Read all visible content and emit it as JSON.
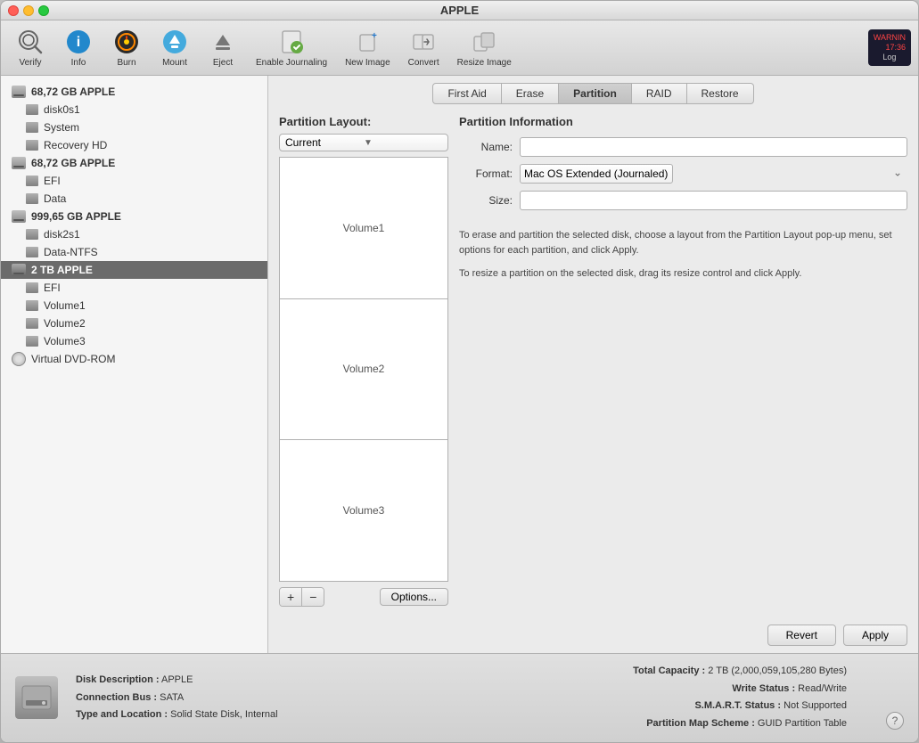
{
  "window": {
    "title": "APPLE"
  },
  "toolbar": {
    "items": [
      {
        "id": "verify",
        "label": "Verify",
        "icon": "verify"
      },
      {
        "id": "info",
        "label": "Info",
        "icon": "info"
      },
      {
        "id": "burn",
        "label": "Burn",
        "icon": "burn"
      },
      {
        "id": "mount",
        "label": "Mount",
        "icon": "mount"
      },
      {
        "id": "eject",
        "label": "Eject",
        "icon": "eject"
      },
      {
        "id": "enable-journaling",
        "label": "Enable Journaling",
        "icon": "journaling"
      },
      {
        "id": "new-image",
        "label": "New Image",
        "icon": "new-image"
      },
      {
        "id": "convert",
        "label": "Convert",
        "icon": "convert"
      },
      {
        "id": "resize-image",
        "label": "Resize Image",
        "icon": "resize-image"
      }
    ],
    "log_label": "Log",
    "log_badge_line1": "WARNIN",
    "log_badge_line2": "17:36"
  },
  "sidebar": {
    "items": [
      {
        "id": "disk1",
        "label": "68,72 GB APPLE",
        "type": "disk",
        "indent": 0
      },
      {
        "id": "disk0s1",
        "label": "disk0s1",
        "type": "volume",
        "indent": 1
      },
      {
        "id": "system",
        "label": "System",
        "type": "volume",
        "indent": 1
      },
      {
        "id": "recovery-hd",
        "label": "Recovery HD",
        "type": "volume",
        "indent": 1
      },
      {
        "id": "disk2",
        "label": "68,72 GB APPLE",
        "type": "disk",
        "indent": 0
      },
      {
        "id": "efi1",
        "label": "EFI",
        "type": "volume",
        "indent": 1
      },
      {
        "id": "data",
        "label": "Data",
        "type": "volume",
        "indent": 1
      },
      {
        "id": "disk3",
        "label": "999,65 GB APPLE",
        "type": "disk",
        "indent": 0
      },
      {
        "id": "disk2s1",
        "label": "disk2s1",
        "type": "volume",
        "indent": 1
      },
      {
        "id": "data-ntfs",
        "label": "Data-NTFS",
        "type": "volume",
        "indent": 1
      },
      {
        "id": "disk4",
        "label": "2 TB APPLE",
        "type": "disk",
        "indent": 0,
        "selected": true
      },
      {
        "id": "efi2",
        "label": "EFI",
        "type": "volume",
        "indent": 1
      },
      {
        "id": "volume1",
        "label": "Volume1",
        "type": "volume",
        "indent": 1
      },
      {
        "id": "volume2",
        "label": "Volume2",
        "type": "volume",
        "indent": 1
      },
      {
        "id": "volume3",
        "label": "Volume3",
        "type": "volume",
        "indent": 1
      },
      {
        "id": "virtual-dvd",
        "label": "Virtual DVD-ROM",
        "type": "dvd",
        "indent": 0
      }
    ]
  },
  "tabs": [
    {
      "id": "first-aid",
      "label": "First Aid"
    },
    {
      "id": "erase",
      "label": "Erase"
    },
    {
      "id": "partition",
      "label": "Partition",
      "active": true
    },
    {
      "id": "raid",
      "label": "RAID"
    },
    {
      "id": "restore",
      "label": "Restore"
    }
  ],
  "partition_layout": {
    "title": "Partition Layout:",
    "dropdown_value": "Current",
    "partitions": [
      {
        "id": "vol1",
        "label": "Volume1"
      },
      {
        "id": "vol2",
        "label": "Volume2"
      },
      {
        "id": "vol3",
        "label": "Volume3"
      }
    ],
    "add_label": "+",
    "remove_label": "−",
    "options_label": "Options..."
  },
  "partition_info": {
    "title": "Partition Information",
    "name_label": "Name:",
    "name_value": "",
    "format_label": "Format:",
    "format_value": "Mac OS Extended (Journaled)",
    "size_label": "Size:",
    "size_value": "",
    "description1": "To erase and partition the selected disk, choose a layout from the Partition Layout pop-up menu, set options for each partition, and click Apply.",
    "description2": "To resize a partition on the selected disk, drag its resize control and click Apply."
  },
  "actions": {
    "revert_label": "Revert",
    "apply_label": "Apply"
  },
  "status_bar": {
    "disk_description_label": "Disk Description :",
    "disk_description_value": "APPLE",
    "connection_bus_label": "Connection Bus :",
    "connection_bus_value": "SATA",
    "type_location_label": "Type and Location :",
    "type_location_value": "Solid State Disk, Internal",
    "total_capacity_label": "Total Capacity :",
    "total_capacity_value": "2 TB (2,000,059,105,280 Bytes)",
    "write_status_label": "Write Status :",
    "write_status_value": "Read/Write",
    "smart_status_label": "S.M.A.R.T. Status :",
    "smart_status_value": "Not Supported",
    "partition_scheme_label": "Partition Map Scheme :",
    "partition_scheme_value": "GUID Partition Table",
    "help_label": "?"
  }
}
